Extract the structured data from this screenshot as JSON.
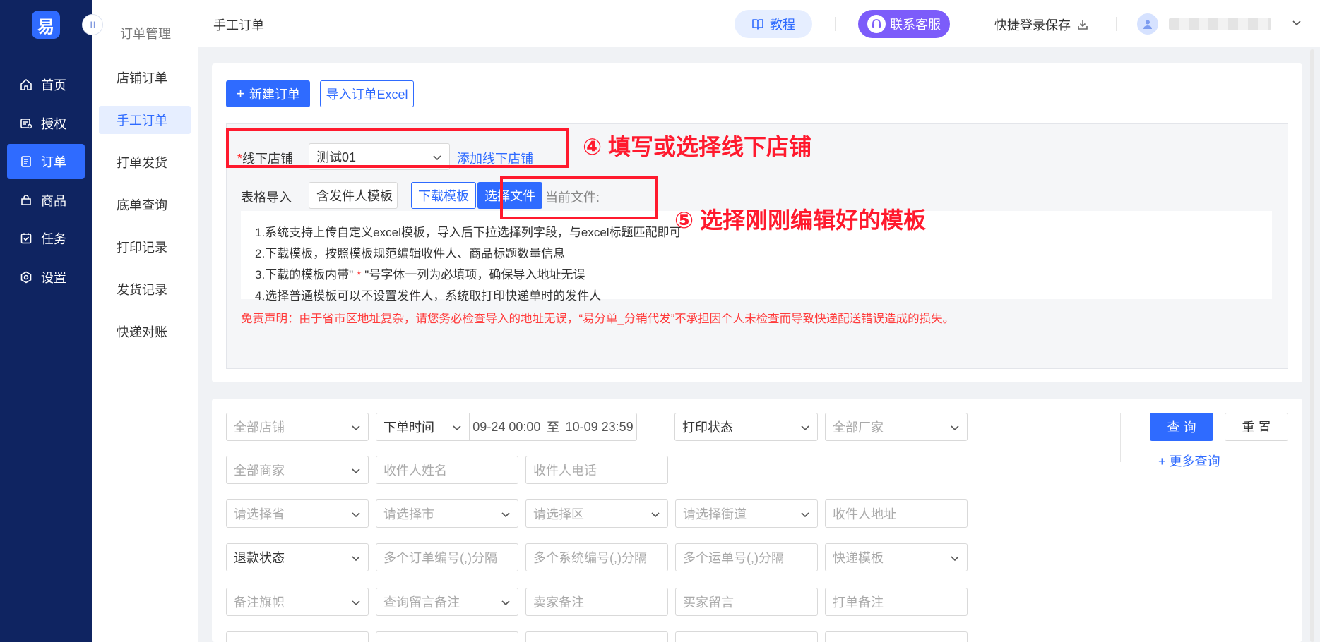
{
  "logo": {
    "char": "易"
  },
  "nav": {
    "items": [
      {
        "label": "首页",
        "icon": "home-icon"
      },
      {
        "label": "授权",
        "icon": "auth-icon"
      },
      {
        "label": "订单",
        "icon": "order-icon"
      },
      {
        "label": "商品",
        "icon": "goods-icon"
      },
      {
        "label": "任务",
        "icon": "task-icon"
      },
      {
        "label": "设置",
        "icon": "settings-icon"
      }
    ],
    "active_index": 2
  },
  "subnav": {
    "title": "订单管理",
    "items": [
      "店铺订单",
      "手工订单",
      "打单发货",
      "底单查询",
      "打印记录",
      "发货记录",
      "快递对账"
    ],
    "active_index": 1
  },
  "topbar": {
    "page_title": "手工订单",
    "tutorial_label": "教程",
    "service_label": "联系客服",
    "quick_save_label": "快捷登录保存"
  },
  "actions": {
    "new_order_label": "新建订单",
    "import_excel_label": "导入订单Excel"
  },
  "form": {
    "store_required_mark": "*",
    "store_label": "线下店铺",
    "store_value": "测试01",
    "add_store_link": "添加线下店铺",
    "table_import_label": "表格导入",
    "template_value": "含发件人模板",
    "download_template_label": "下载模板",
    "choose_file_label": "选择文件",
    "current_file_label": "当前文件:"
  },
  "annotations": {
    "step4": "④ 填写或选择线下店铺",
    "step5": "⑤ 选择刚刚编辑好的模板"
  },
  "instructions": {
    "line1": "1.系统支持上传自定义excel模板，导入后下拉选择列字段，与excel标题匹配即可",
    "line2": "2.下载模板，按照模板规范编辑收件人、商品标题数量信息",
    "line3_pre": "3.下载的模板内带\"",
    "line3_star": " * ",
    "line3_post": "\"号字体一列为必填项，确保导入地址无误",
    "line4": "4.选择普通模板可以不设置发件人，系统取打印快递单时的发件人"
  },
  "disclaimer": "免责声明：由于省市区地址复杂，请您务必检查导入的地址无误，“易分单_分销代发”不承担因个人未检查而导致快递配送错误造成的损失。",
  "filters": {
    "all_stores": "全部店铺",
    "order_time": "下单时间",
    "date_start": "09-24 00:00",
    "date_sep": "至",
    "date_end": "10-09 23:59",
    "print_status": "打印状态",
    "all_factories": "全部厂家",
    "all_merchants": "全部商家",
    "recipient_name": "收件人姓名",
    "recipient_phone": "收件人电话",
    "province": "请选择省",
    "city": "请选择市",
    "district": "请选择区",
    "street": "请选择街道",
    "recipient_address": "收件人地址",
    "refund_status": "退款状态",
    "order_nos": "多个订单编号(,)分隔",
    "system_nos": "多个系统编号(,)分隔",
    "waybill_nos": "多个运单号(,)分隔",
    "express_template": "快递模板",
    "remark_flag": "备注旗帜",
    "query_remark": "查询留言备注",
    "seller_remark": "卖家备注",
    "buyer_message": "买家留言",
    "print_remark": "打单备注",
    "query_label": "查 询",
    "reset_label": "重 置",
    "more_query_label": "+ 更多查询"
  },
  "colors": {
    "rail_bg": "#0f2461",
    "primary": "#2f6bff",
    "service_purple": "#7c5cfa",
    "annotation_red": "#ff1a2e"
  }
}
